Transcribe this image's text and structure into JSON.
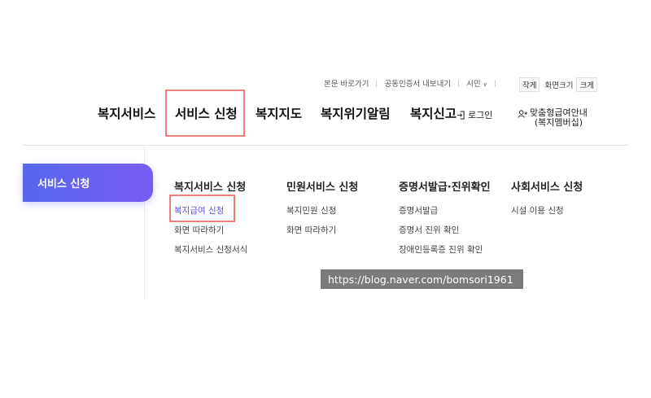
{
  "utility_bar": {
    "skip_content": "본문 바로가기",
    "cert_export": "공동인증서 내보내기",
    "city_select": "시민"
  },
  "font_size": {
    "smaller": "작게",
    "label": "화면크기",
    "larger": "크게"
  },
  "gnb": {
    "items": [
      "복지서비스",
      "서비스 신청",
      "복지지도",
      "복지위기알림",
      "복지신고"
    ],
    "login": "로그인",
    "custom_line1": "맞춤형급여안내",
    "custom_line2": "(복지멤버십)"
  },
  "side": {
    "active_menu": "서비스 신청"
  },
  "columns": [
    {
      "heading": "복지서비스 신청",
      "items": [
        "복지급여 신청",
        "화면 따라하기",
        "복지서비스 신청서식"
      ]
    },
    {
      "heading": "민원서비스 신청",
      "items": [
        "복지민원 신청",
        "화면 따라하기"
      ]
    },
    {
      "heading": "증명서발급·진위확인",
      "items": [
        "증명서발급",
        "증명서 진위 확인",
        "장애인등록증 진위 확인"
      ]
    },
    {
      "heading": "사회서비스 신청",
      "items": [
        "시설 이용 신청"
      ]
    }
  ],
  "watermark": "https://blog.naver.com/bomsori1961",
  "colors": {
    "accent_start": "#5867ec",
    "accent_end": "#7a5cf2",
    "highlight_box": "#ef7f7a",
    "active_link": "#5a4ee6"
  }
}
